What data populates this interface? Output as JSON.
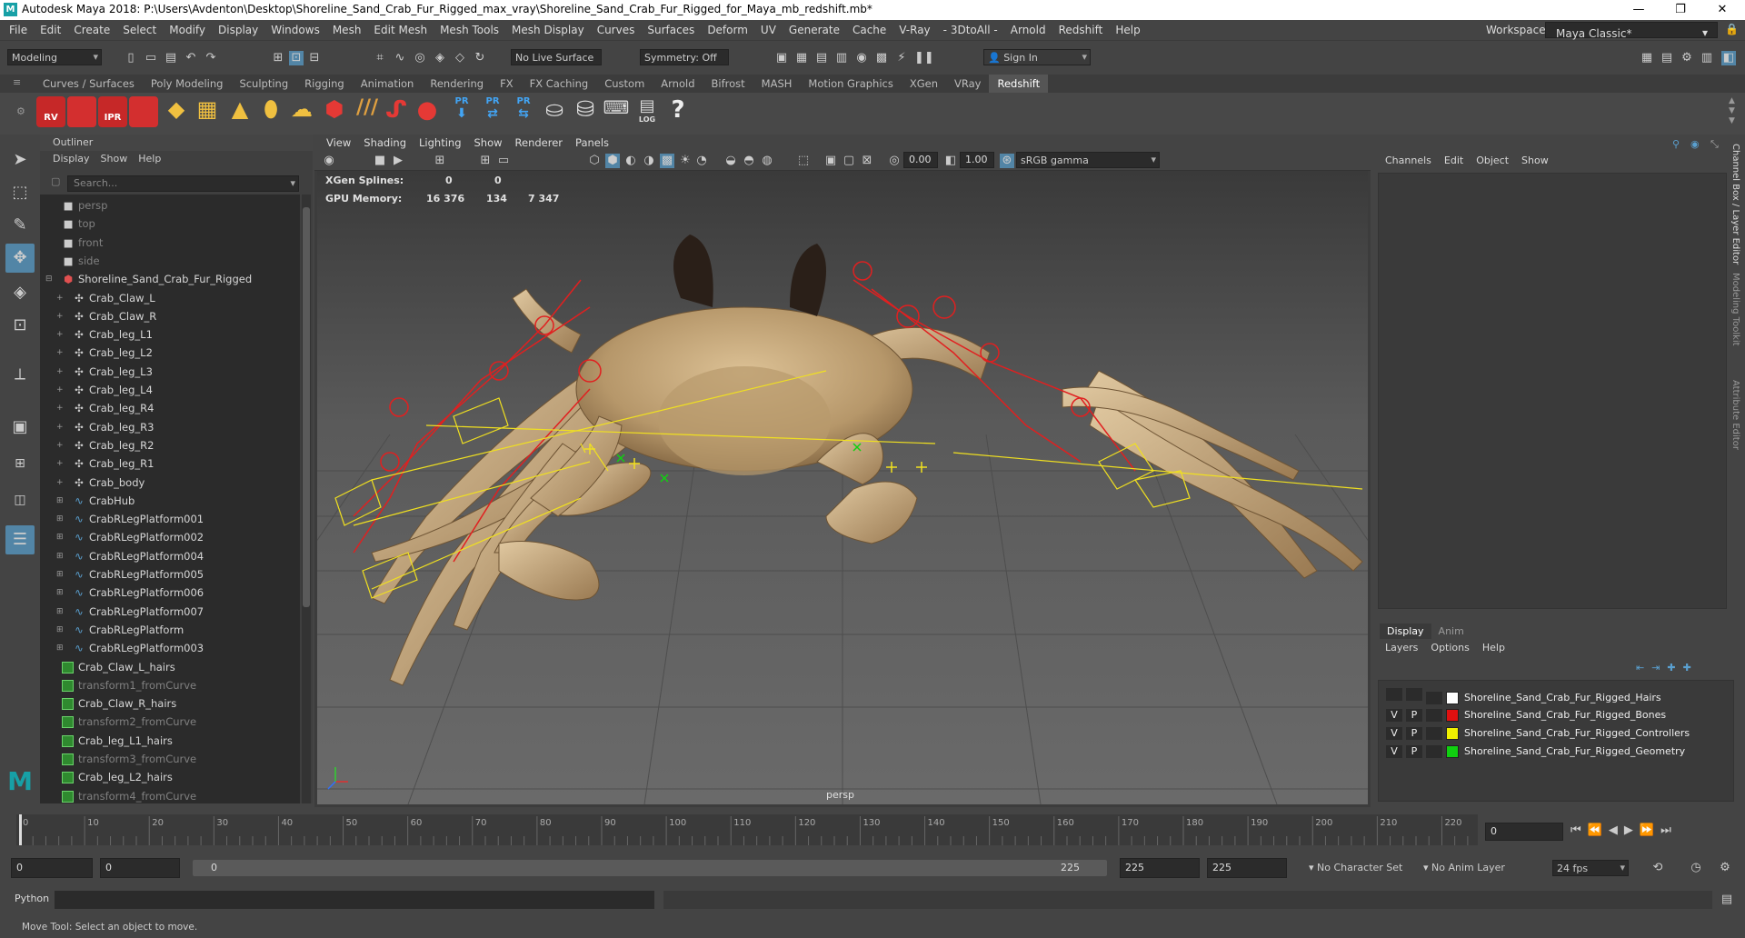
{
  "window": {
    "title": "Autodesk Maya 2018: P:\\Users\\Avdenton\\Desktop\\Shoreline_Sand_Crab_Fur_Rigged_max_vray\\Shoreline_Sand_Crab_Fur_Rigged_for_Maya_mb_redshift.mb*",
    "icon": "maya-logo-icon"
  },
  "menus": [
    "File",
    "Edit",
    "Create",
    "Select",
    "Modify",
    "Display",
    "Windows",
    "Mesh",
    "Edit Mesh",
    "Mesh Tools",
    "Mesh Display",
    "Curves",
    "Surfaces",
    "Deform",
    "UV",
    "Generate",
    "Cache",
    "V-Ray",
    "- 3DtoAll -",
    "Arnold",
    "Redshift",
    "Help"
  ],
  "workspace": {
    "label": "Workspace :",
    "value": "Maya Classic*"
  },
  "status": {
    "mode": "Modeling",
    "live_surface": "No Live Surface",
    "symmetry": "Symmetry: Off",
    "sign_in": "Sign In"
  },
  "shelf_tabs": [
    "Curves / Surfaces",
    "Poly Modeling",
    "Sculpting",
    "Rigging",
    "Animation",
    "Rendering",
    "FX",
    "FX Caching",
    "Custom",
    "Arnold",
    "Bifrost",
    "MASH",
    "Motion Graphics",
    "XGen",
    "VRay",
    "Redshift"
  ],
  "shelf_active": "Redshift",
  "shelf_labels": {
    "rv": "RV",
    "ipr": "IPR",
    "pr1": "PR",
    "pr2": "PR",
    "pr3": "PR",
    "log": "LOG"
  },
  "outliner": {
    "title": "Outliner",
    "menu": [
      "Display",
      "Show",
      "Help"
    ],
    "search_placeholder": "Search...",
    "items": [
      {
        "label": "persp",
        "dim": true,
        "indent": 0,
        "icon": "camera-icon"
      },
      {
        "label": "top",
        "dim": true,
        "indent": 0,
        "icon": "camera-icon"
      },
      {
        "label": "front",
        "dim": true,
        "indent": 0,
        "icon": "camera-icon"
      },
      {
        "label": "side",
        "dim": true,
        "indent": 0,
        "icon": "camera-icon"
      },
      {
        "label": "Shoreline_Sand_Crab_Fur_Rigged",
        "dim": false,
        "indent": 0,
        "icon": "group-icon",
        "exp": "⊟"
      },
      {
        "label": "Crab_Claw_L",
        "dim": false,
        "indent": 1,
        "icon": "joint-icon",
        "exp": "+"
      },
      {
        "label": "Crab_Claw_R",
        "dim": false,
        "indent": 1,
        "icon": "joint-icon",
        "exp": "+"
      },
      {
        "label": "Crab_leg_L1",
        "dim": false,
        "indent": 1,
        "icon": "joint-icon",
        "exp": "+"
      },
      {
        "label": "Crab_leg_L2",
        "dim": false,
        "indent": 1,
        "icon": "joint-icon",
        "exp": "+"
      },
      {
        "label": "Crab_leg_L3",
        "dim": false,
        "indent": 1,
        "icon": "joint-icon",
        "exp": "+"
      },
      {
        "label": "Crab_leg_L4",
        "dim": false,
        "indent": 1,
        "icon": "joint-icon",
        "exp": "+"
      },
      {
        "label": "Crab_leg_R4",
        "dim": false,
        "indent": 1,
        "icon": "joint-icon",
        "exp": "+"
      },
      {
        "label": "Crab_leg_R3",
        "dim": false,
        "indent": 1,
        "icon": "joint-icon",
        "exp": "+"
      },
      {
        "label": "Crab_leg_R2",
        "dim": false,
        "indent": 1,
        "icon": "joint-icon",
        "exp": "+"
      },
      {
        "label": "Crab_leg_R1",
        "dim": false,
        "indent": 1,
        "icon": "joint-icon",
        "exp": "+"
      },
      {
        "label": "Crab_body",
        "dim": false,
        "indent": 1,
        "icon": "joint-icon",
        "exp": "+"
      },
      {
        "label": "CrabHub",
        "dim": false,
        "indent": 1,
        "icon": "curve-icon",
        "exp": "⊞"
      },
      {
        "label": "CrabRLegPlatform001",
        "dim": false,
        "indent": 1,
        "icon": "curve-icon",
        "exp": "⊞"
      },
      {
        "label": "CrabRLegPlatform002",
        "dim": false,
        "indent": 1,
        "icon": "curve-icon",
        "exp": "⊞"
      },
      {
        "label": "CrabRLegPlatform004",
        "dim": false,
        "indent": 1,
        "icon": "curve-icon",
        "exp": "⊞"
      },
      {
        "label": "CrabRLegPlatform005",
        "dim": false,
        "indent": 1,
        "icon": "curve-icon",
        "exp": "⊞"
      },
      {
        "label": "CrabRLegPlatform006",
        "dim": false,
        "indent": 1,
        "icon": "curve-icon",
        "exp": "⊞"
      },
      {
        "label": "CrabRLegPlatform007",
        "dim": false,
        "indent": 1,
        "icon": "curve-icon",
        "exp": "⊞"
      },
      {
        "label": "CrabRLegPlatform",
        "dim": false,
        "indent": 1,
        "icon": "curve-icon",
        "exp": "⊞"
      },
      {
        "label": "CrabRLegPlatform003",
        "dim": false,
        "indent": 1,
        "icon": "curve-icon",
        "exp": "⊞"
      },
      {
        "label": "Crab_Claw_L_hairs",
        "dim": false,
        "indent": 0,
        "icon": "hair-icon"
      },
      {
        "label": "transform1_fromCurve",
        "dim": true,
        "indent": 0,
        "icon": "hair-icon"
      },
      {
        "label": "Crab_Claw_R_hairs",
        "dim": false,
        "indent": 0,
        "icon": "hair-icon"
      },
      {
        "label": "transform2_fromCurve",
        "dim": true,
        "indent": 0,
        "icon": "hair-icon"
      },
      {
        "label": "Crab_leg_L1_hairs",
        "dim": false,
        "indent": 0,
        "icon": "hair-icon"
      },
      {
        "label": "transform3_fromCurve",
        "dim": true,
        "indent": 0,
        "icon": "hair-icon"
      },
      {
        "label": "Crab_leg_L2_hairs",
        "dim": false,
        "indent": 0,
        "icon": "hair-icon"
      },
      {
        "label": "transform4_fromCurve",
        "dim": true,
        "indent": 0,
        "icon": "hair-icon"
      }
    ]
  },
  "viewport": {
    "menu": [
      "View",
      "Shading",
      "Lighting",
      "Show",
      "Renderer",
      "Panels"
    ],
    "exposure": "0.00",
    "gamma": "1.00",
    "color_space": "sRGB gamma",
    "hud": {
      "xgen_label": "XGen Splines:",
      "xgen_a": "0",
      "xgen_b": "0",
      "gpu_label": "GPU Memory:",
      "gpu_a": "16 376",
      "gpu_b": "134",
      "gpu_c": "7 347"
    },
    "camera": "persp"
  },
  "channel_box": {
    "menu": [
      "Channels",
      "Edit",
      "Object",
      "Show"
    ],
    "side_tabs": [
      "Channel Box / Layer Editor",
      "Modeling Toolkit",
      "Attribute Editor"
    ],
    "layer_tabs": [
      "Display",
      "Anim"
    ],
    "layer_menu": [
      "Layers",
      "Options",
      "Help"
    ],
    "layers": [
      {
        "v": "",
        "p": "",
        "name": "Shoreline_Sand_Crab_Fur_Rigged_Hairs",
        "color": "#ffffff"
      },
      {
        "v": "V",
        "p": "P",
        "name": "Shoreline_Sand_Crab_Fur_Rigged_Bones",
        "color": "#e01010"
      },
      {
        "v": "V",
        "p": "P",
        "name": "Shoreline_Sand_Crab_Fur_Rigged_Controllers",
        "color": "#f0f000"
      },
      {
        "v": "V",
        "p": "P",
        "name": "Shoreline_Sand_Crab_Fur_Rigged_Geometry",
        "color": "#10d010"
      }
    ]
  },
  "timeline": {
    "ticks": [
      0,
      10,
      20,
      30,
      40,
      50,
      60,
      70,
      80,
      90,
      100,
      110,
      120,
      130,
      140,
      150,
      160,
      170,
      180,
      190,
      200,
      210,
      220
    ],
    "current_frame": "0",
    "range_max": 225
  },
  "range": {
    "start": "0",
    "anim_start": "0",
    "slider_start": "0",
    "slider_end": "225",
    "end": "225",
    "anim_end": "225",
    "character_set": "No Character Set",
    "anim_layer": "No Anim Layer",
    "fps": "24 fps"
  },
  "cmd": {
    "label": "Python"
  },
  "help": {
    "text": "Move Tool: Select an object to move."
  }
}
